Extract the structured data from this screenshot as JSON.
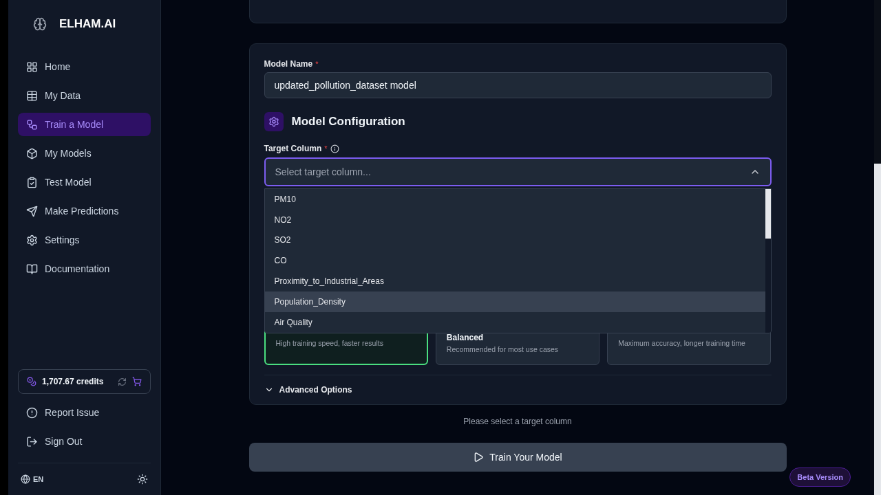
{
  "brand": {
    "name": "ELHAM.AI"
  },
  "nav": [
    {
      "label": "Home",
      "selected": false
    },
    {
      "label": "My Data",
      "selected": false
    },
    {
      "label": "Train a Model",
      "selected": true
    },
    {
      "label": "My Models",
      "selected": false
    },
    {
      "label": "Test Model",
      "selected": false
    },
    {
      "label": "Make Predictions",
      "selected": false
    },
    {
      "label": "Settings",
      "selected": false
    },
    {
      "label": "Documentation",
      "selected": false
    }
  ],
  "credits": {
    "text": "1,707.67 credits"
  },
  "footer_nav": [
    {
      "label": "Report Issue"
    },
    {
      "label": "Sign Out"
    }
  ],
  "language": "EN",
  "form": {
    "model_name_label": "Model Name",
    "required_mark": "*",
    "model_name_value": "updated_pollution_dataset model",
    "section_title": "Model Configuration",
    "target_label": "Target Column",
    "target_placeholder": "Select target column...",
    "dropdown_open": true,
    "options": [
      {
        "label": "PM10",
        "highlighted": false
      },
      {
        "label": "NO2",
        "highlighted": false
      },
      {
        "label": "SO2",
        "highlighted": false
      },
      {
        "label": "CO",
        "highlighted": false
      },
      {
        "label": "Proximity_to_Industrial_Areas",
        "highlighted": false
      },
      {
        "label": "Population_Density",
        "highlighted": true
      },
      {
        "label": "Air Quality",
        "highlighted": false
      }
    ],
    "speed_options": [
      {
        "description": "High training speed, faster results",
        "selected": true
      },
      {
        "title": "Balanced",
        "description": "Recommended for most use cases",
        "selected": false
      },
      {
        "description": "Maximum accuracy, longer training time",
        "selected": false
      }
    ],
    "advanced_label": "Advanced Options"
  },
  "hint": "Please select a target column",
  "train_button": "Train Your Model",
  "badge": "Beta Version"
}
